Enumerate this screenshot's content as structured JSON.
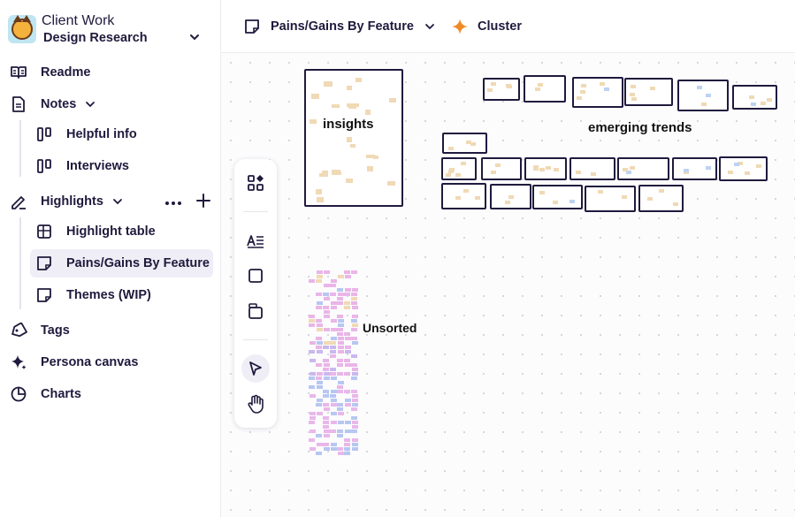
{
  "workspace": {
    "name": "Client Work",
    "project": "Design Research"
  },
  "sidebar": {
    "readme": "Readme",
    "notes": "Notes",
    "notes_children": [
      "Helpful info",
      "Interviews"
    ],
    "highlights": "Highlights",
    "highlights_children": [
      "Highlight table",
      "Pains/Gains By Feature",
      "Themes (WIP)"
    ],
    "tags": "Tags",
    "persona": "Persona canvas",
    "charts": "Charts"
  },
  "topbar": {
    "page_title": "Pains/Gains By Feature",
    "cluster_label": "Cluster"
  },
  "canvas": {
    "labels": {
      "insights": "insights",
      "emerging": "emerging trends",
      "unsorted": "Unsorted"
    }
  },
  "colors": {
    "accent": "#f08a24",
    "text": "#1f1a3d",
    "active_bg": "#efeef6"
  },
  "icons": {
    "workspace": "cat-logo-icon",
    "readme": "book-open-icon",
    "notes": "document-icon",
    "board": "board-columns-icon",
    "highlights": "pen-icon",
    "table": "table-grid-icon",
    "sticky": "sticky-note-icon",
    "tags": "tag-icon",
    "persona": "sparkle-icon",
    "charts": "pie-chart-icon",
    "cluster": "sparkle-icon"
  }
}
